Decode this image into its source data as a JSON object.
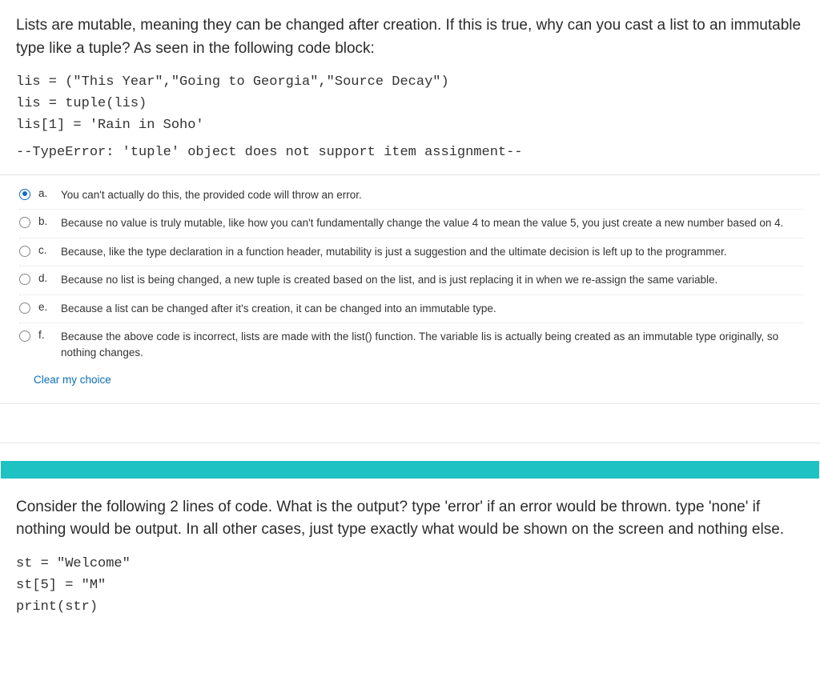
{
  "q1": {
    "prompt": "Lists are mutable, meaning they can be changed after creation. If this is true, why can you cast a list to an immutable type like a tuple? As seen in  the following code block:",
    "code": [
      "lis = (\"This Year\",\"Going to Georgia\",\"Source Decay\")",
      "lis = tuple(lis)",
      "lis[1] = 'Rain in Soho'"
    ],
    "error": "--TypeError: 'tuple' object does not support item assignment--",
    "options": [
      {
        "letter": "a.",
        "text": "You can't actually do this, the provided code will throw an error.",
        "selected": true
      },
      {
        "letter": "b.",
        "text": "Because no value is truly mutable, like how you can't fundamentally change the value 4 to mean the value 5, you just create a new number based on 4.",
        "selected": false
      },
      {
        "letter": "c.",
        "text": "Because, like the type declaration in a function header, mutability is just a suggestion and the ultimate decision is left up to the programmer.",
        "selected": false
      },
      {
        "letter": "d.",
        "text": "Because no list is being changed, a new tuple is created based on the list, and is just replacing it in when we re-assign the same variable.",
        "selected": false
      },
      {
        "letter": "e.",
        "text": "Because a list can be changed after it's creation, it can be changed into an immutable type.",
        "selected": false
      },
      {
        "letter": "f.",
        "text": "Because the above code is incorrect, lists are made with the list() function. The variable lis is actually being created as an immutable type originally, so nothing changes.",
        "selected": false
      }
    ],
    "clear": "Clear my choice"
  },
  "q2": {
    "prompt": "Consider the following 2 lines of code. What is the output? type 'error' if an error would be thrown. type 'none' if nothing would be output. In all other cases, just type exactly what would be shown on the screen and nothing else.",
    "code": [
      "st = \"Welcome\"",
      "st[5] = \"M\"",
      "print(str)"
    ]
  }
}
